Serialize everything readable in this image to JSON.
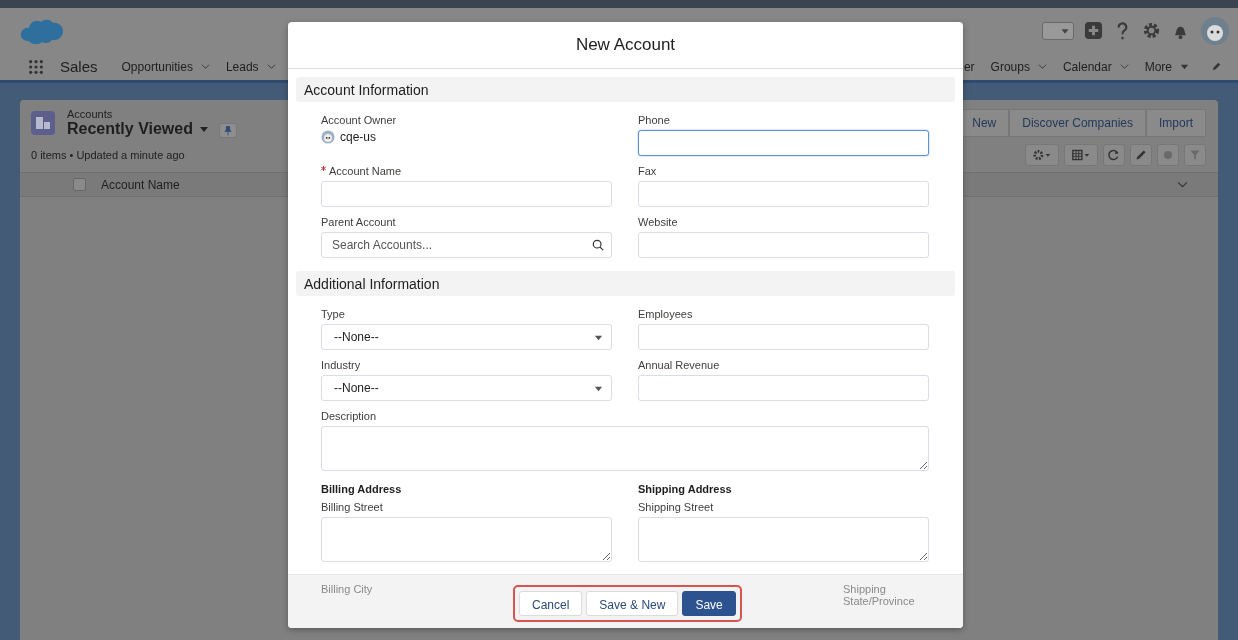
{
  "app": {
    "name": "Sales",
    "nav": [
      {
        "label": "Opportunities",
        "kind": "menu"
      },
      {
        "label": "Leads",
        "kind": "menu"
      },
      {
        "label": "er",
        "kind": "plain"
      },
      {
        "label": "Groups",
        "kind": "menu"
      },
      {
        "label": "Calendar",
        "kind": "menu"
      },
      {
        "label": "More",
        "kind": "more"
      }
    ]
  },
  "list": {
    "object": "Accounts",
    "view": "Recently Viewed",
    "status": "0 items • Updated a minute ago",
    "buttons": [
      "New",
      "Discover Companies",
      "Import"
    ],
    "column": "Account Name",
    "select_all_checked": false
  },
  "modal": {
    "title": "New Account",
    "sections": [
      {
        "title": "Account Information",
        "fields": [
          {
            "kind": "owner",
            "label": "Account Owner",
            "value": "cqe-us",
            "required": false
          },
          {
            "kind": "input",
            "label": "Phone",
            "required": false,
            "focused": true
          },
          {
            "kind": "input",
            "label": "Account Name",
            "required": true,
            "focused": false
          },
          {
            "kind": "input",
            "label": "Fax",
            "required": false,
            "focused": false
          },
          {
            "kind": "lookup",
            "label": "Parent Account",
            "placeholder": "Search Accounts...",
            "required": false
          },
          {
            "kind": "input",
            "label": "Website",
            "required": false,
            "focused": false
          }
        ]
      },
      {
        "title": "Additional Information",
        "fields": [
          {
            "kind": "select",
            "label": "Type",
            "value": "--None--",
            "required": false
          },
          {
            "kind": "input",
            "label": "Employees",
            "required": false,
            "focused": false
          },
          {
            "kind": "select",
            "label": "Industry",
            "value": "--None--",
            "required": false
          },
          {
            "kind": "input",
            "label": "Annual Revenue",
            "required": false,
            "focused": false
          },
          {
            "kind": "wide",
            "label": "Description",
            "required": false
          },
          {
            "kind": "heading",
            "label": "Billing Address"
          },
          {
            "kind": "heading",
            "label": "Shipping Address"
          },
          {
            "kind": "textarea",
            "label": "Billing Street",
            "required": false
          },
          {
            "kind": "textarea",
            "label": "Shipping Street",
            "required": false
          }
        ]
      }
    ],
    "hidden_labels": [
      "Billing City",
      "Shipping State/Province"
    ],
    "buttons": [
      {
        "label": "Cancel",
        "kind": "neutral"
      },
      {
        "label": "Save & New",
        "kind": "neutral"
      },
      {
        "label": "Save",
        "kind": "brand"
      }
    ]
  }
}
